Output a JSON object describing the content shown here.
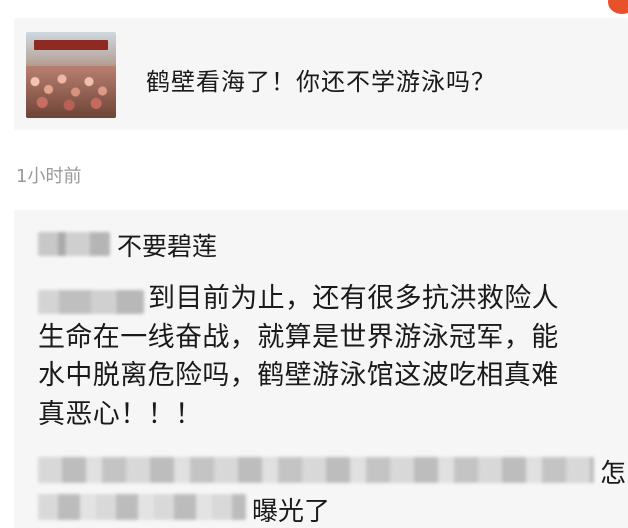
{
  "shared_post": {
    "title": "鹤壁看海了！你还不学游泳吗？"
  },
  "timestamp": "1小时前",
  "comment": {
    "username": "不要碧莲",
    "lines": [
      "到目前为止，还有很多抗洪救险人",
      "生命在一线奋战，就算是世界游泳冠军，能",
      "水中脱离危险吗，鹤壁游泳馆这波吃相真难",
      "真恶心！！！"
    ],
    "reply_fragment_1": "怎",
    "reply_fragment_2": "曝光了"
  },
  "colors": {
    "accent": "#e8522a",
    "card_background": "#f6f6f6",
    "timestamp": "#9a9a9a"
  }
}
